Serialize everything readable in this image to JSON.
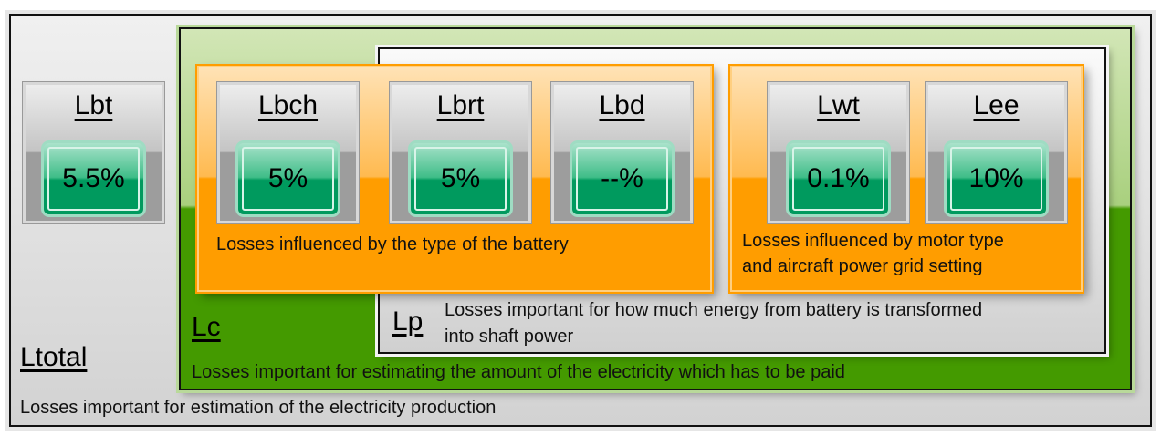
{
  "ltotal": {
    "label": "Ltotal",
    "description": "Losses important for estimation of the electricity production"
  },
  "lc": {
    "label": "Lc",
    "description": "Losses important for estimating the amount of the electricity which has to be paid"
  },
  "lp": {
    "label": "Lp",
    "description_line1": "Losses important for how much energy from battery is transformed",
    "description_line2": "into shaft power"
  },
  "battery_group": {
    "description": "Losses influenced by the type of the battery"
  },
  "motor_group": {
    "description_line1": "Losses influenced by motor type",
    "description_line2": "and aircraft power grid setting"
  },
  "cards": [
    {
      "label": "Lbt",
      "value": "5.5%"
    },
    {
      "label": "Lbch",
      "value": "5%"
    },
    {
      "label": "Lbrt",
      "value": "5%"
    },
    {
      "label": "Lbd",
      "value": "--%"
    },
    {
      "label": "Lwt",
      "value": "0.1%"
    },
    {
      "label": "Lee",
      "value": "10%"
    }
  ]
}
